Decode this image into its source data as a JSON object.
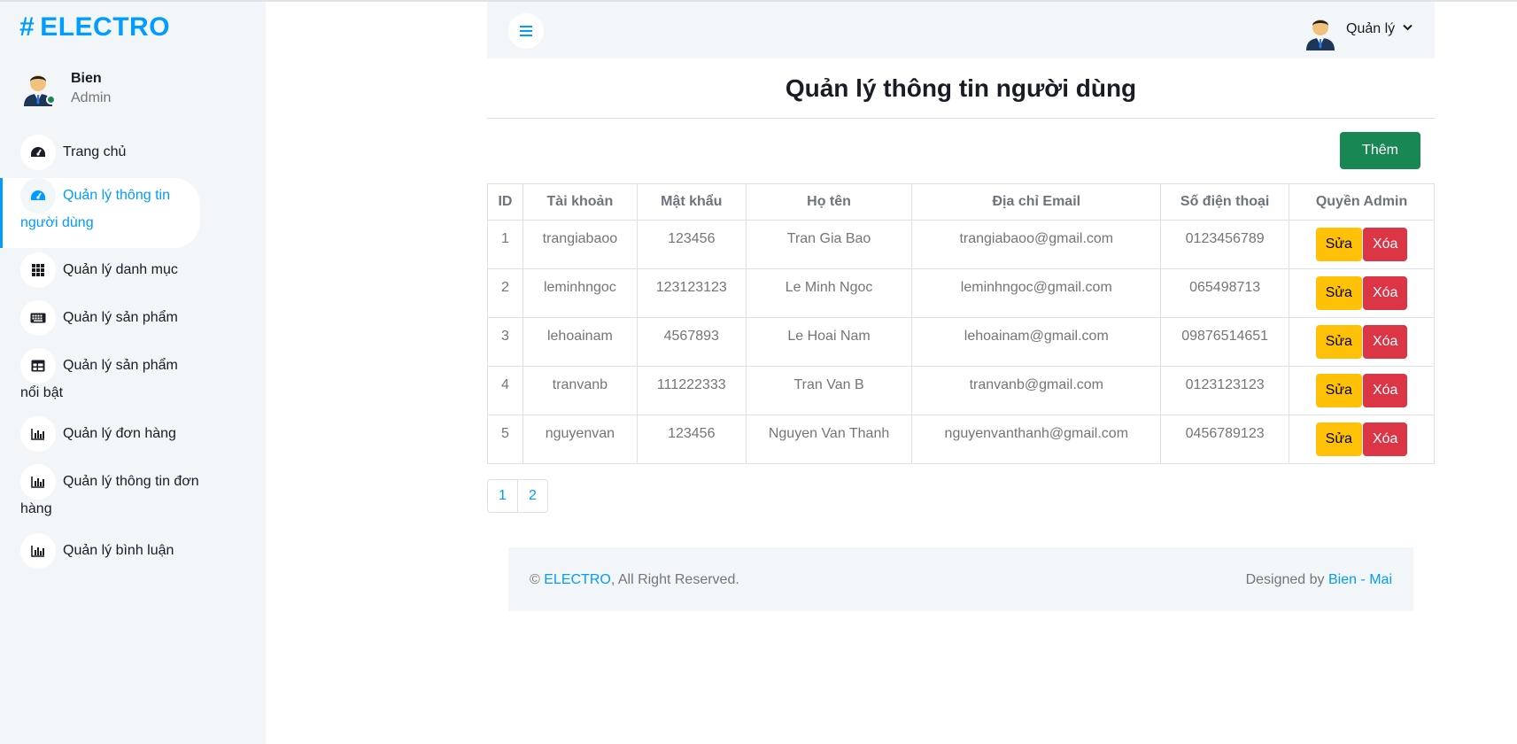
{
  "brand": {
    "hash": "#",
    "name": "ELECTRO"
  },
  "sidebar_user": {
    "name": "Bien",
    "role": "Admin"
  },
  "sidebar": {
    "items": [
      {
        "label": "Trang chủ",
        "icon": "gauge-icon",
        "active": false
      },
      {
        "label": "Quản lý thông tin người dùng",
        "icon": "gauge-icon",
        "active": true
      },
      {
        "label": "Quản lý danh mục",
        "icon": "grid-icon",
        "active": false
      },
      {
        "label": "Quản lý sản phẩm",
        "icon": "keyboard-icon",
        "active": false
      },
      {
        "label": "Quản lý sản phẩm nổi bật",
        "icon": "table-icon",
        "active": false
      },
      {
        "label": "Quản lý đơn hàng",
        "icon": "bar-chart-icon",
        "active": false
      },
      {
        "label": "Quản lý thông tin đơn hàng",
        "icon": "bar-chart-icon",
        "active": false
      },
      {
        "label": "Quản lý bình luận",
        "icon": "bar-chart-icon",
        "active": false
      }
    ]
  },
  "topbar": {
    "user_label": "Quản lý"
  },
  "page": {
    "title": "Quản lý thông tin người dùng",
    "add_label": "Thêm"
  },
  "table": {
    "headers": [
      "ID",
      "Tài khoản",
      "Mật khẩu",
      "Họ tên",
      "Địa chỉ Email",
      "Số điện thoại",
      "Quyền Admin"
    ],
    "rows": [
      {
        "id": "1",
        "account": "trangiabaoo",
        "password": "123456",
        "name": "Tran Gia Bao",
        "email": "trangiabaoo@gmail.com",
        "phone": "0123456789"
      },
      {
        "id": "2",
        "account": "leminhngoc",
        "password": "123123123",
        "name": "Le Minh Ngoc",
        "email": "leminhngoc@gmail.com",
        "phone": "065498713"
      },
      {
        "id": "3",
        "account": "lehoainam",
        "password": "4567893",
        "name": "Le Hoai Nam",
        "email": "lehoainam@gmail.com",
        "phone": "09876514651"
      },
      {
        "id": "4",
        "account": "tranvanb",
        "password": "111222333",
        "name": "Tran Van B",
        "email": "tranvanb@gmail.com",
        "phone": "0123123123"
      },
      {
        "id": "5",
        "account": "nguyenvan",
        "password": "123456",
        "name": "Nguyen Van Thanh",
        "email": "nguyenvanthanh@gmail.com",
        "phone": "0456789123"
      }
    ],
    "edit_label": "Sửa",
    "delete_label": "Xóa"
  },
  "pagination": [
    "1",
    "2"
  ],
  "footer": {
    "copyright_symbol": "©",
    "brand_link": "ELECTRO",
    "rights": ", All Right Reserved.",
    "designed_by": "Designed by",
    "designer_link": "Bien - Mai"
  },
  "colors": {
    "primary": "#009cff",
    "sidebar_bg": "#f3f6f9",
    "add": "#198754",
    "edit": "#ffc107",
    "delete": "#dc3545"
  }
}
